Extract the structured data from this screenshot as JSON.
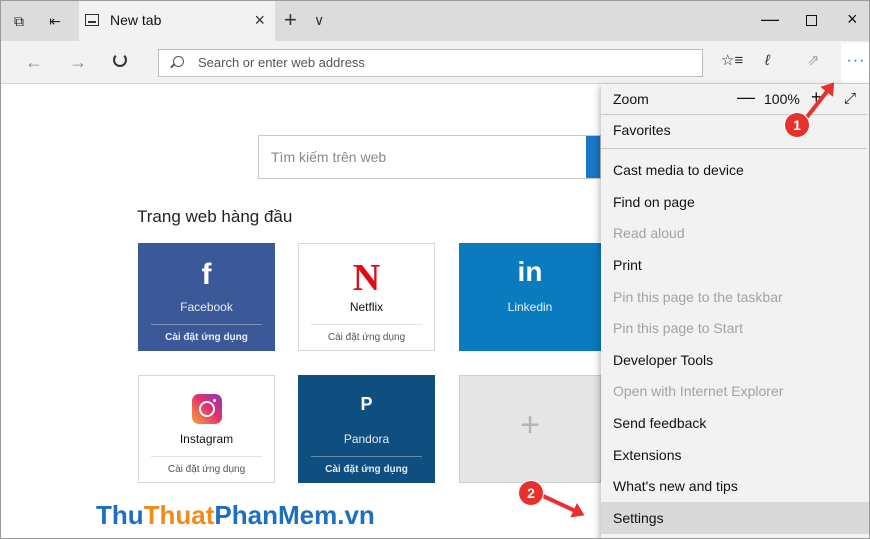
{
  "browser": {
    "tab_title": "New tab",
    "address_placeholder": "Search or enter web address",
    "more_label": "···"
  },
  "page": {
    "search_placeholder": "Tìm kiếm trên web",
    "top_sites_heading": "Trang web hàng đầu",
    "tiles": [
      {
        "name": "Facebook",
        "app": "Cài đặt ứng dụng",
        "logo": "f",
        "color": "#3b5899"
      },
      {
        "name": "Netflix",
        "app": "Cài đặt ứng dụng",
        "logo": "N",
        "color": "#e50914"
      },
      {
        "name": "Linkedin",
        "logo": "in",
        "color": "#0b7bbf"
      },
      {
        "name": "Instagram",
        "app": "Cài đặt ứng dụng",
        "color": "#e1306c"
      },
      {
        "name": "Pandora",
        "app": "Cài đặt ứng dụng",
        "logo": "P",
        "color": "#0f4f7f"
      },
      {
        "add_label": "+"
      }
    ],
    "watermark": [
      "Thu",
      "Thuat",
      "PhanMem.vn"
    ]
  },
  "menu": {
    "zoom_label": "Zoom",
    "zoom_value": "100%",
    "zoom_minus": "—",
    "zoom_plus": "+",
    "items": [
      {
        "label": "Favorites",
        "enabled": true
      },
      {
        "label": "Cast media to device",
        "enabled": true
      },
      {
        "label": "Find on page",
        "enabled": true
      },
      {
        "label": "Read aloud",
        "enabled": false
      },
      {
        "label": "Print",
        "enabled": true
      },
      {
        "label": "Pin this page to the taskbar",
        "enabled": false
      },
      {
        "label": "Pin this page to Start",
        "enabled": false
      },
      {
        "label": "Developer Tools",
        "enabled": true
      },
      {
        "label": "Open with Internet Explorer",
        "enabled": false
      },
      {
        "label": "Send feedback",
        "enabled": true
      },
      {
        "label": "Extensions",
        "enabled": true
      },
      {
        "label": "What's new and tips",
        "enabled": true
      },
      {
        "label": "Settings",
        "enabled": true,
        "highlighted": true
      }
    ]
  },
  "annotations": {
    "step1": "1",
    "step2": "2",
    "color": "#e8302c"
  }
}
